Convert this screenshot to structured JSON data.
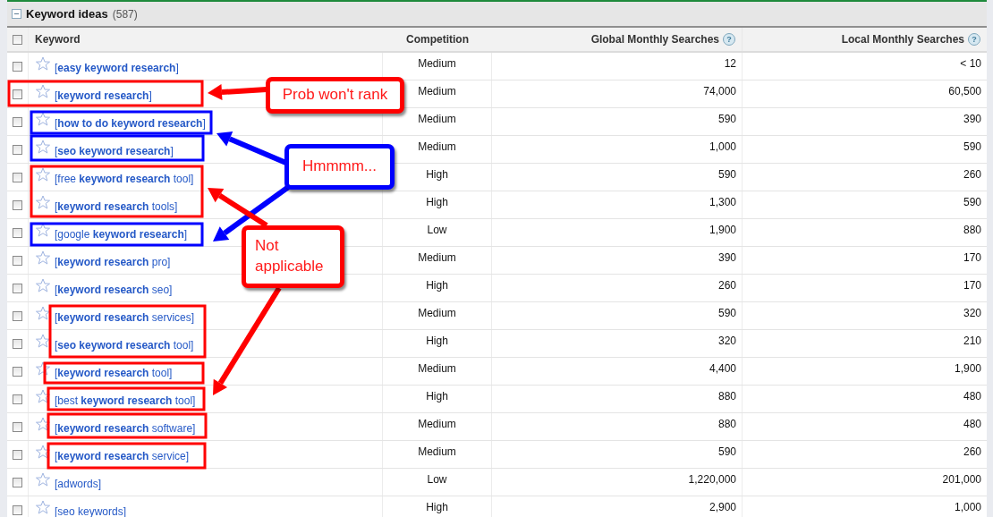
{
  "panel": {
    "title": "Keyword ideas",
    "count": "(587)",
    "expanded": true
  },
  "columns": [
    {
      "label": "Keyword"
    },
    {
      "label": "Competition"
    },
    {
      "label": "Global Monthly Searches",
      "help": "?"
    },
    {
      "label": "Local Monthly Searches",
      "help": "?"
    }
  ],
  "select_all": {
    "checked": false
  },
  "rows": [
    {
      "checked": false,
      "starred": false,
      "keyword": "[**easy keyword research**]",
      "competition": "Medium",
      "global": "12",
      "local": "< 10"
    },
    {
      "checked": false,
      "starred": false,
      "keyword": "[**keyword research**]",
      "competition": "Medium",
      "global": "74,000",
      "local": "60,500"
    },
    {
      "checked": false,
      "starred": false,
      "keyword": "[**how to do keyword research**]",
      "competition": "Medium",
      "global": "590",
      "local": "390"
    },
    {
      "checked": false,
      "starred": false,
      "keyword": "[**seo keyword research**]",
      "competition": "Medium",
      "global": "1,000",
      "local": "590"
    },
    {
      "checked": false,
      "starred": false,
      "keyword": "[free **keyword research** tool]",
      "competition": "High",
      "global": "590",
      "local": "260"
    },
    {
      "checked": false,
      "starred": false,
      "keyword": "[**keyword research** tools]",
      "competition": "High",
      "global": "1,300",
      "local": "590"
    },
    {
      "checked": false,
      "starred": false,
      "keyword": "[google **keyword research**]",
      "competition": "Low",
      "global": "1,900",
      "local": "880"
    },
    {
      "checked": false,
      "starred": false,
      "keyword": "[**keyword research** pro]",
      "competition": "Medium",
      "global": "390",
      "local": "170"
    },
    {
      "checked": false,
      "starred": false,
      "keyword": "[**keyword research** seo]",
      "competition": "High",
      "global": "260",
      "local": "170"
    },
    {
      "checked": false,
      "starred": false,
      "keyword": "[**keyword research** services]",
      "competition": "Medium",
      "global": "590",
      "local": "320"
    },
    {
      "checked": false,
      "starred": false,
      "keyword": "[**seo keyword research** tool]",
      "competition": "High",
      "global": "320",
      "local": "210"
    },
    {
      "checked": false,
      "starred": false,
      "keyword": "[**keyword research** tool]",
      "competition": "Medium",
      "global": "4,400",
      "local": "1,900"
    },
    {
      "checked": false,
      "starred": false,
      "keyword": "[best **keyword research** tool]",
      "competition": "High",
      "global": "880",
      "local": "480"
    },
    {
      "checked": false,
      "starred": false,
      "keyword": "[**keyword research** software]",
      "competition": "Medium",
      "global": "880",
      "local": "480"
    },
    {
      "checked": false,
      "starred": false,
      "keyword": "[**keyword research** service]",
      "competition": "Medium",
      "global": "590",
      "local": "260"
    },
    {
      "checked": false,
      "starred": false,
      "keyword": "[adwords]",
      "competition": "Low",
      "global": "1,220,000",
      "local": "201,000"
    },
    {
      "checked": false,
      "starred": false,
      "keyword": "[seo keywords]",
      "competition": "High",
      "global": "2,900",
      "local": "1,000"
    }
  ],
  "highlight_boxes": [
    {
      "color": "#ff0000"
    },
    {
      "color": "#0000ff"
    },
    {
      "color": "#0000ff"
    },
    {
      "color": "#ff0000"
    },
    {
      "color": "#0000ff"
    },
    {
      "color": "#ff0000"
    },
    {
      "color": "#ff0000"
    },
    {
      "color": "#ff0000"
    },
    {
      "color": "#ff0000"
    },
    {
      "color": "#ff0000"
    }
  ],
  "callouts": [
    {
      "text": "Prob won't rank",
      "color": "#ff0000"
    },
    {
      "text": "Hmmmm...",
      "color": "#0000ff"
    },
    {
      "text": "Not applicable",
      "color": "#ff0000"
    }
  ]
}
